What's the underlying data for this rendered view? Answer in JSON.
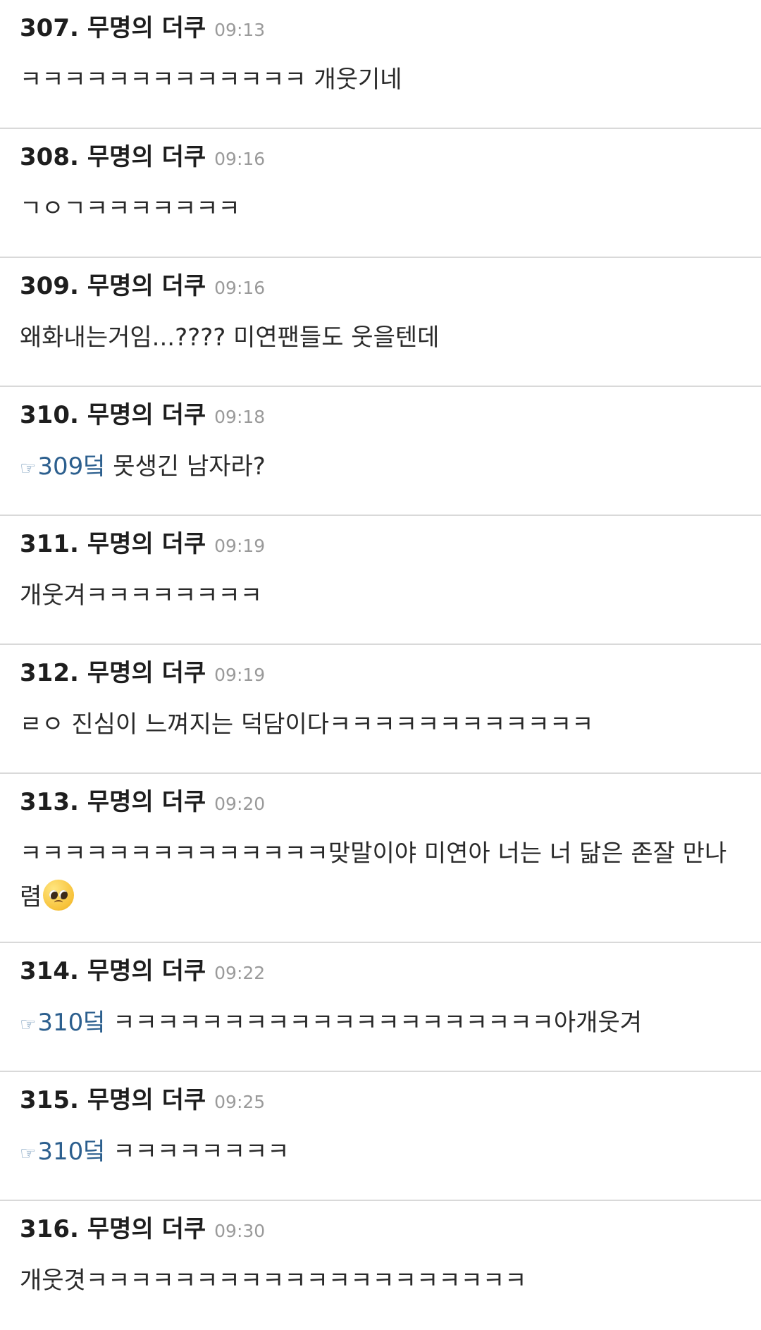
{
  "comments": [
    {
      "num": "307.",
      "author": "무명의 더쿠",
      "time": "09:13",
      "reply": "",
      "text": "ㅋㅋㅋㅋㅋㅋㅋㅋㅋㅋㅋㅋㅋ 개웃기네"
    },
    {
      "num": "308.",
      "author": "무명의 더쿠",
      "time": "09:16",
      "reply": "",
      "text": "ㄱㅇㄱㅋㅋㅋㅋㅋㅋㅋ"
    },
    {
      "num": "309.",
      "author": "무명의 더쿠",
      "time": "09:16",
      "reply": "",
      "text": "왜화내는거임...???? 미연팬들도 웃을텐데"
    },
    {
      "num": "310.",
      "author": "무명의 더쿠",
      "time": "09:18",
      "reply": "309덬",
      "text": " 못생긴 남자라?"
    },
    {
      "num": "311.",
      "author": "무명의 더쿠",
      "time": "09:19",
      "reply": "",
      "text": "개웃겨ㅋㅋㅋㅋㅋㅋㅋㅋ"
    },
    {
      "num": "312.",
      "author": "무명의 더쿠",
      "time": "09:19",
      "reply": "",
      "text": "ㄹㅇ 진심이 느껴지는 덕담이다ㅋㅋㅋㅋㅋㅋㅋㅋㅋㅋㅋㅋ"
    },
    {
      "num": "313.",
      "author": "무명의 더쿠",
      "time": "09:20",
      "reply": "",
      "text": "ㅋㅋㅋㅋㅋㅋㅋㅋㅋㅋㅋㅋㅋㅋ맞말이야 미연아 너는 너 닮은 존잘 만나렴",
      "emoji": "pleading-face-emoji"
    },
    {
      "num": "314.",
      "author": "무명의 더쿠",
      "time": "09:22",
      "reply": "310덬",
      "text": " ㅋㅋㅋㅋㅋㅋㅋㅋㅋㅋㅋㅋㅋㅋㅋㅋㅋㅋㅋㅋ아개웃겨"
    },
    {
      "num": "315.",
      "author": "무명의 더쿠",
      "time": "09:25",
      "reply": "310덬",
      "text": " ㅋㅋㅋㅋㅋㅋㅋㅋ"
    },
    {
      "num": "316.",
      "author": "무명의 더쿠",
      "time": "09:30",
      "reply": "",
      "text": "개웃겻ㅋㅋㅋㅋㅋㅋㅋㅋㅋㅋㅋㅋㅋㅋㅋㅋㅋㅋㅋㅋ"
    }
  ],
  "reply_icon": "☞",
  "colors": {
    "reply_link": "#2c5f8e",
    "timestamp": "#9a9a9a",
    "divider": "#d9d9d9"
  }
}
